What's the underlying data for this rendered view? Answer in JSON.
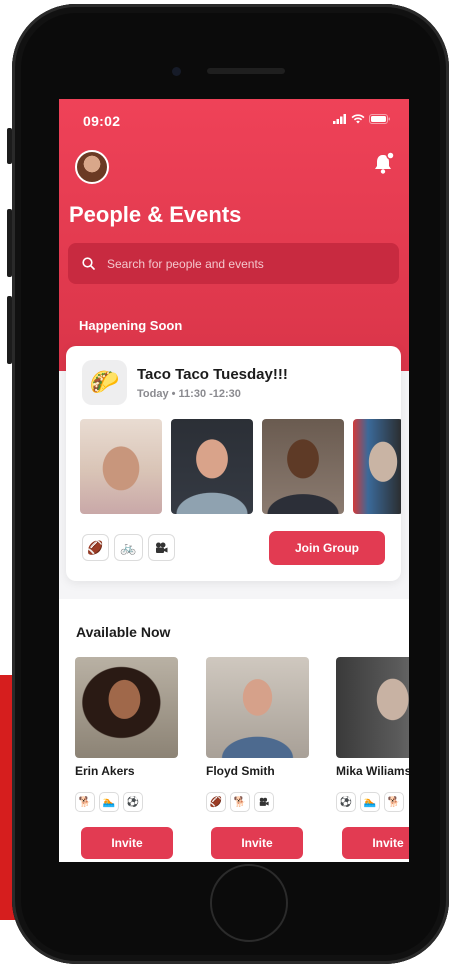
{
  "status_bar": {
    "time": "09:02"
  },
  "header": {
    "title": "People & Events",
    "search_placeholder": "Search for people and events"
  },
  "happening_soon": {
    "heading": "Happening Soon",
    "event": {
      "icon": "taco-icon",
      "title": "Taco Taco Tuesday!!!",
      "time": "Today • 11:30 -12:30",
      "photos": [
        "person-photo-1",
        "person-photo-2",
        "person-photo-3",
        "person-photo-4"
      ],
      "tags": [
        "football-icon",
        "bicycle-icon",
        "video-camera-icon"
      ],
      "join_label": "Join Group"
    }
  },
  "available_now": {
    "heading": "Available Now",
    "people": [
      {
        "name": "Erin Akers",
        "tags": [
          "dog-icon",
          "swimmer-icon",
          "soccer-icon"
        ],
        "invite_label": "Invite"
      },
      {
        "name": "Floyd Smith",
        "tags": [
          "football-icon",
          "dog-icon",
          "video-camera-icon"
        ],
        "invite_label": "Invite"
      },
      {
        "name": "Mika Wiliamson",
        "tags": [
          "soccer-icon",
          "swimmer-icon",
          "dog-icon"
        ],
        "invite_label": "Invite"
      }
    ]
  },
  "colors": {
    "brand": "#e23b52",
    "header_top": "#ef4258",
    "search_bg": "#c82a40"
  }
}
